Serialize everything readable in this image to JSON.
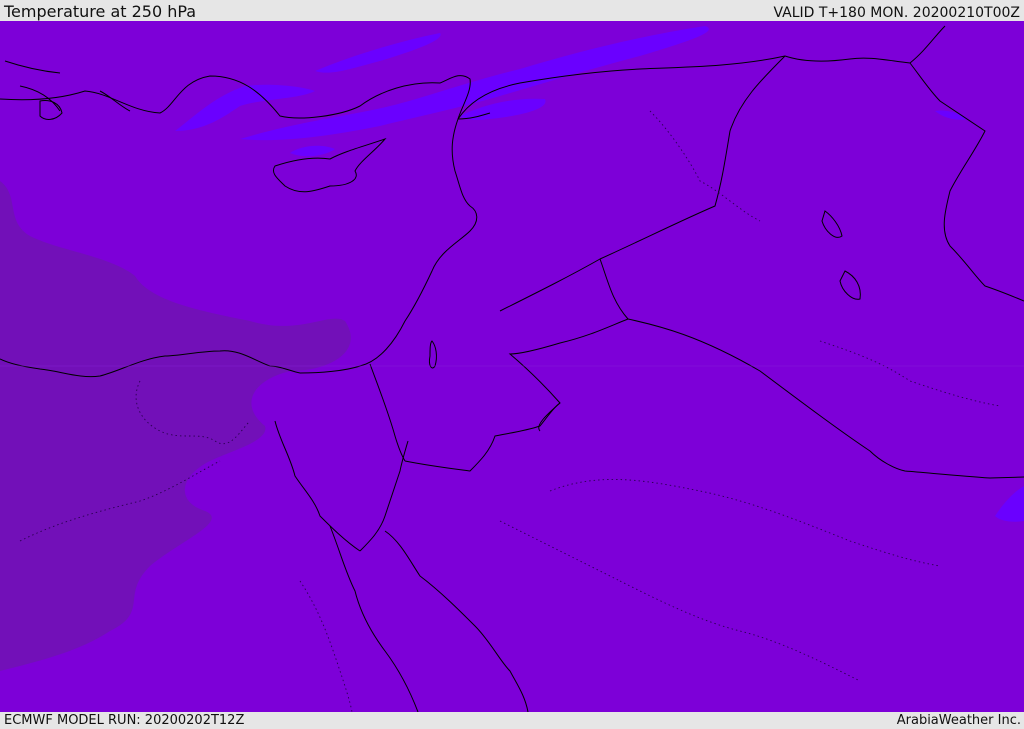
{
  "header": {
    "title": "Temperature at 250 hPa",
    "valid": "VALID T+180 MON. 20200210T00Z"
  },
  "footer": {
    "model_run": "ECMWF MODEL RUN: 20200202T12Z",
    "credit": "ArabiaWeather Inc."
  },
  "map": {
    "colors": {
      "background": "#7d00d8",
      "warmer_shade": "#7210b8",
      "colder_shade": "#6a00ff",
      "coastline": "#000000"
    }
  }
}
